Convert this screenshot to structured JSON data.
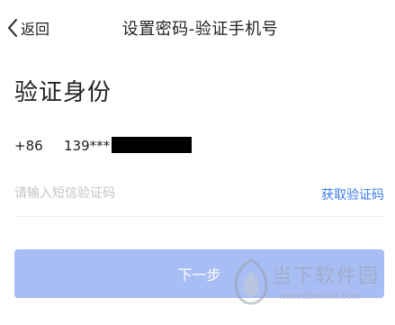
{
  "header": {
    "back_label": "返回",
    "title": "设置密码-验证手机号"
  },
  "main": {
    "heading": "验证身份",
    "phone": {
      "country_code": "+86",
      "number_prefix": "139***"
    },
    "code_field": {
      "placeholder": "请输入短信验证码",
      "value": "",
      "get_code_label": "获取验证码"
    },
    "next_button_label": "下一步"
  },
  "watermark": {
    "title": "当下软件园",
    "url": "www.downxia.com"
  },
  "colors": {
    "accent": "#3d7ce8",
    "button_disabled": "#a8bdf4",
    "text": "#222222",
    "placeholder": "#c4c4c4"
  },
  "icons": {
    "back": "chevron-left-icon",
    "watermark_logo": "downxia-logo-icon"
  }
}
